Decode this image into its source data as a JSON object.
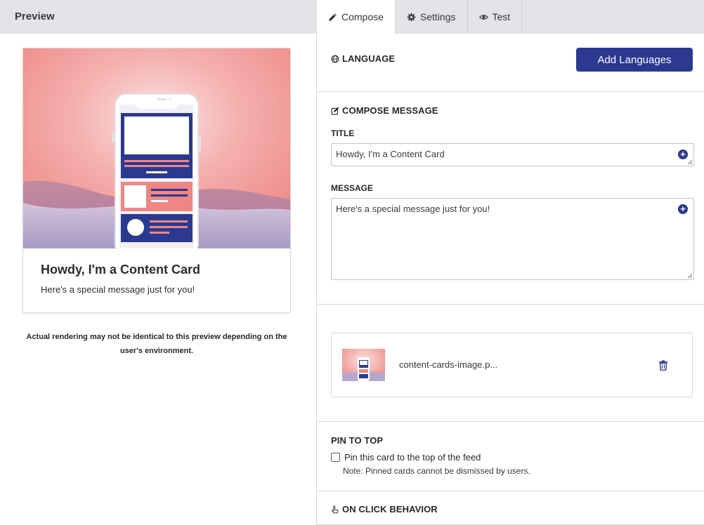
{
  "preview": {
    "header": "Preview",
    "card": {
      "title": "Howdy, I'm a Content Card",
      "message": "Here's a special message just for you!"
    },
    "disclaimer": "Actual rendering may not be identical to this preview depending on the user's environment."
  },
  "tabs": [
    {
      "label": "Compose",
      "icon": "pencil-icon",
      "active": true
    },
    {
      "label": "Settings",
      "icon": "gear-icon",
      "active": false
    },
    {
      "label": "Test",
      "icon": "eye-icon",
      "active": false
    }
  ],
  "language": {
    "title": "LANGUAGE",
    "icon": "globe-icon",
    "add_button": "Add Languages"
  },
  "compose": {
    "title": "COMPOSE MESSAGE",
    "icon": "edit-icon",
    "title_label": "TITLE",
    "title_value": "Howdy, I'm a Content Card",
    "message_label": "MESSAGE",
    "message_value": "Here's a special message just for you!"
  },
  "file": {
    "name": "content-cards-image.p..."
  },
  "pin": {
    "title": "PIN TO TOP",
    "checkbox_label": "Pin this card to the top of the feed",
    "checked": false,
    "note": "Note: Pinned cards cannot be dismissed by users."
  },
  "click": {
    "title": "ON CLICK BEHAVIOR",
    "icon": "pointer-icon"
  },
  "colors": {
    "accent": "#2b3990",
    "header_bg": "#e4e4e8",
    "image_pink": "#ef8f8c",
    "image_purple": "#a89ac4"
  }
}
